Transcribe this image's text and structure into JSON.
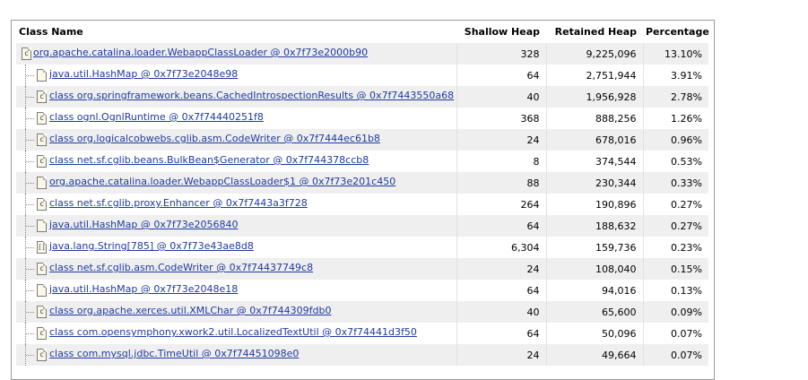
{
  "columns": {
    "class_name": "Class Name",
    "shallow_heap": "Shallow Heap",
    "retained_heap": "Retained Heap",
    "percentage": "Percentage"
  },
  "root": {
    "name": "org.apache.catalina.loader.WebappClassLoader @ 0x7f73e2000b90",
    "icon": "class-loader-icon",
    "shallow": "328",
    "retained": "9,225,096",
    "pct": "13.10%"
  },
  "rows": [
    {
      "name": "java.util.HashMap @ 0x7f73e2048e98",
      "icon": "object-icon",
      "shallow": "64",
      "retained": "2,751,944",
      "pct": "3.91%"
    },
    {
      "name": "class org.springframework.beans.CachedIntrospectionResults @ 0x7f7443550a68",
      "icon": "class-icon",
      "shallow": "40",
      "retained": "1,956,928",
      "pct": "2.78%"
    },
    {
      "name": "class ognl.OgnlRuntime @ 0x7f74440251f8",
      "icon": "class-icon",
      "shallow": "368",
      "retained": "888,256",
      "pct": "1.26%"
    },
    {
      "name": "class org.logicalcobwebs.cglib.asm.CodeWriter @ 0x7f7444ec61b8",
      "icon": "class-icon",
      "shallow": "24",
      "retained": "678,016",
      "pct": "0.96%"
    },
    {
      "name": "class net.sf.cglib.beans.BulkBean$Generator @ 0x7f744378ccb8",
      "icon": "class-icon",
      "shallow": "8",
      "retained": "374,544",
      "pct": "0.53%"
    },
    {
      "name": "org.apache.catalina.loader.WebappClassLoader$1 @ 0x7f73e201c450",
      "icon": "object-icon",
      "shallow": "88",
      "retained": "230,344",
      "pct": "0.33%"
    },
    {
      "name": "class net.sf.cglib.proxy.Enhancer @ 0x7f7443a3f728",
      "icon": "class-icon",
      "shallow": "264",
      "retained": "190,896",
      "pct": "0.27%"
    },
    {
      "name": "java.util.HashMap @ 0x7f73e2056840",
      "icon": "object-icon",
      "shallow": "64",
      "retained": "188,632",
      "pct": "0.27%"
    },
    {
      "name": "java.lang.String[785] @ 0x7f73e43ae8d8",
      "icon": "array-icon",
      "shallow": "6,304",
      "retained": "159,736",
      "pct": "0.23%"
    },
    {
      "name": "class net.sf.cglib.asm.CodeWriter @ 0x7f74437749c8",
      "icon": "class-icon",
      "shallow": "24",
      "retained": "108,040",
      "pct": "0.15%"
    },
    {
      "name": "java.util.HashMap @ 0x7f73e2048e18",
      "icon": "object-icon",
      "shallow": "64",
      "retained": "94,016",
      "pct": "0.13%"
    },
    {
      "name": "class org.apache.xerces.util.XMLChar @ 0x7f744309fdb0",
      "icon": "class-icon",
      "shallow": "40",
      "retained": "65,600",
      "pct": "0.09%"
    },
    {
      "name": "class com.opensymphony.xwork2.util.LocalizedTextUtil @ 0x7f74441d3f50",
      "icon": "class-icon",
      "shallow": "64",
      "retained": "50,096",
      "pct": "0.07%"
    },
    {
      "name": "class com.mysql.jdbc.TimeUtil @ 0x7f74451098e0",
      "icon": "class-icon",
      "shallow": "24",
      "retained": "49,664",
      "pct": "0.07%"
    }
  ]
}
